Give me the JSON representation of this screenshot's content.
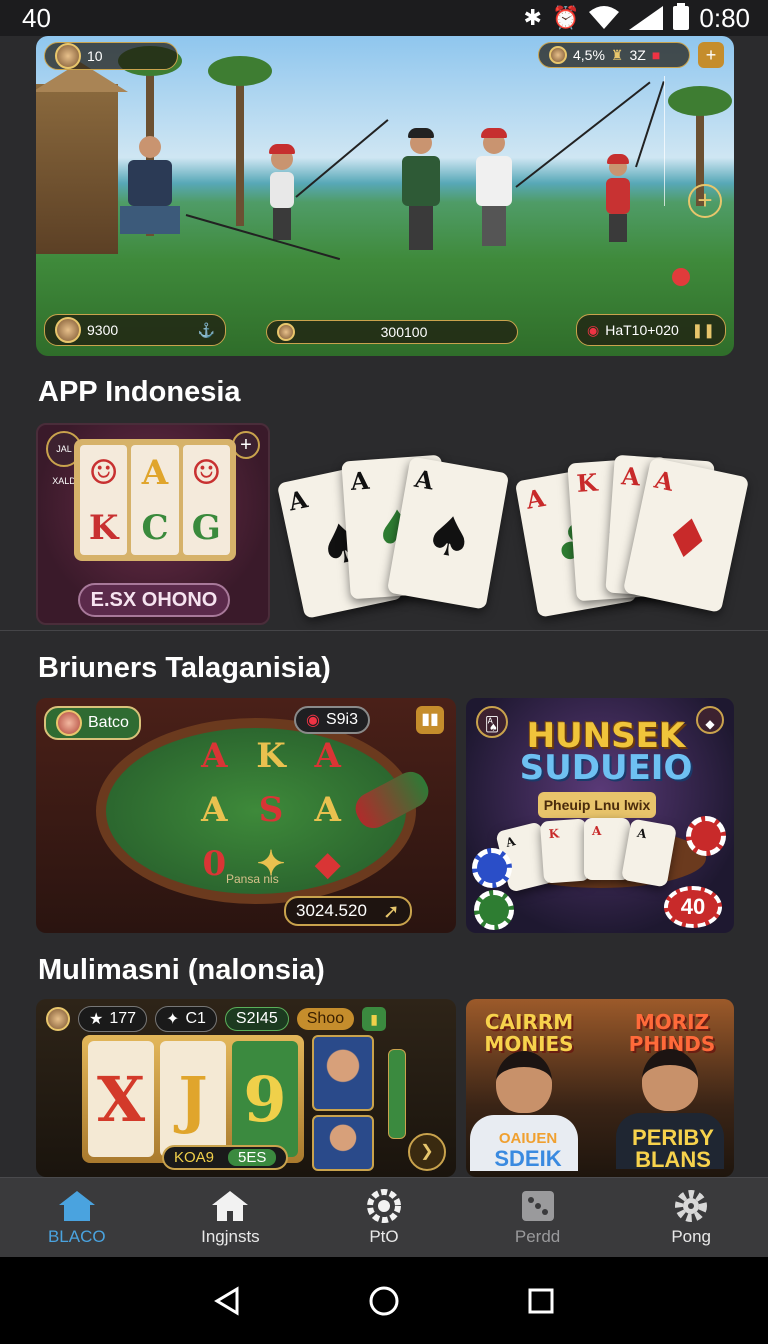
{
  "status_bar": {
    "time_left": "40",
    "time_right": "0:80"
  },
  "banner": {
    "hud_top_left": "10",
    "hud_top_right": "4,5%",
    "hud_top_right_2": "3Z",
    "hud_bottom_left": "9300",
    "hud_bottom_center": "300100",
    "hud_bottom_right": "HaT10+020"
  },
  "section1": {
    "title": "APP Indonesia",
    "slot_label": "E.SX OHONO",
    "slot_badge": "JAL XALD"
  },
  "section2": {
    "title": "Briuners Talaganisia)",
    "table_pill_left": "Batco",
    "table_pill_right": "S9i3",
    "table_felt_text": "Pansa nis",
    "table_score": "3024.520",
    "felt_symbols": [
      "A",
      "K",
      "A",
      "A",
      "S",
      "A",
      "0",
      "✦",
      "◆"
    ],
    "poker_title_line1": "HUNSEK",
    "poker_title_line2": "SUDUEIO",
    "poker_sub": "Pheuip Lnu lwix",
    "poker_chip_label": "40"
  },
  "section3": {
    "title": "Mulimasni (nalonsia)",
    "slot_hud_1": "177",
    "slot_hud_2": "C1",
    "slot_hud_3": "S2I45",
    "slot_hud_4": "Shoo",
    "slot_reels": [
      "X",
      "J",
      "9"
    ],
    "slot_bottom_1": "KOA9",
    "slot_bottom_2": "5ES",
    "movie_title_left": "CAIRRM MONIES",
    "movie_title_right": "MORIZ PHINDS",
    "movie_label_left_1": "OAIUEN",
    "movie_label_left_2": "SDEIK",
    "movie_label_right_1": "PERIBY",
    "movie_label_right_2": "BLANS"
  },
  "bottom_nav": {
    "items": [
      {
        "label": "BLACO",
        "icon": "home-icon"
      },
      {
        "label": "Ingjnsts",
        "icon": "house-icon"
      },
      {
        "label": "PtO",
        "icon": "gear-ring-icon"
      },
      {
        "label": "Perdd",
        "icon": "dice-icon"
      },
      {
        "label": "Pong",
        "icon": "gear-icon"
      }
    ]
  },
  "colors": {
    "background": "#2b2b2d",
    "nav_active": "#4aa3df",
    "gold": "#c9a34d"
  }
}
